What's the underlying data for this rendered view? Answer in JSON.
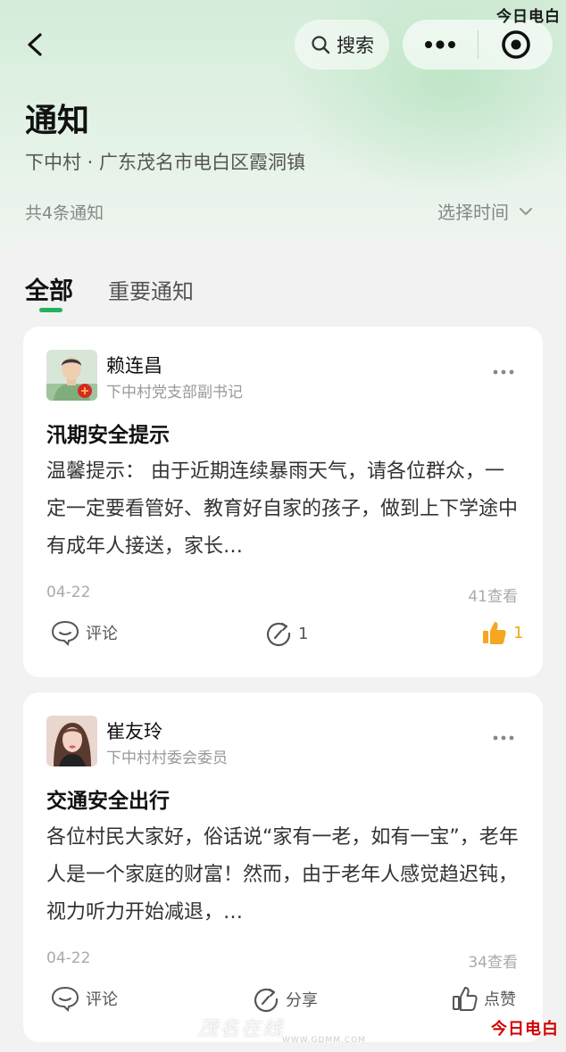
{
  "watermark": {
    "top": "今日电白",
    "bottom": "今日电白",
    "site": "茂名在线",
    "url": "WWW.GDMM.COM"
  },
  "header": {
    "search_label": "搜索",
    "title": "通知",
    "location": "下中村 · 广东茂名市电白区霞洞镇",
    "count": "共4条通知",
    "time_filter": "选择时间"
  },
  "tabs": [
    {
      "label": "全部",
      "active": true
    },
    {
      "label": "重要通知",
      "active": false
    }
  ],
  "posts": [
    {
      "author": "赖连昌",
      "role": "下中村党支部副书记",
      "title": "汛期安全提示",
      "body": "温馨提示： 由于近期连续暴雨天气，请各位群众，一定一定要看管好、教育好自家的孩子，做到上下学途中有成年人接送，家长…",
      "date": "04-22",
      "views": "41查看",
      "comment_label": "评论",
      "share_label": "1",
      "like_label": "1",
      "liked": true
    },
    {
      "author": "崔友玲",
      "role": "下中村村委会委员",
      "title": "交通安全出行",
      "body": "各位村民大家好，俗话说“家有一老，如有一宝”，老年人是一个家庭的财富！然而，由于老年人感觉趋迟钝，视力听力开始减退，…",
      "date": "04-22",
      "views": "34查看",
      "comment_label": "评论",
      "share_label": "分享",
      "like_label": "点赞",
      "liked": false
    }
  ],
  "colors": {
    "accent": "#22b35e",
    "like_active": "#f5a623",
    "header_bg": "#d4ecd9"
  }
}
